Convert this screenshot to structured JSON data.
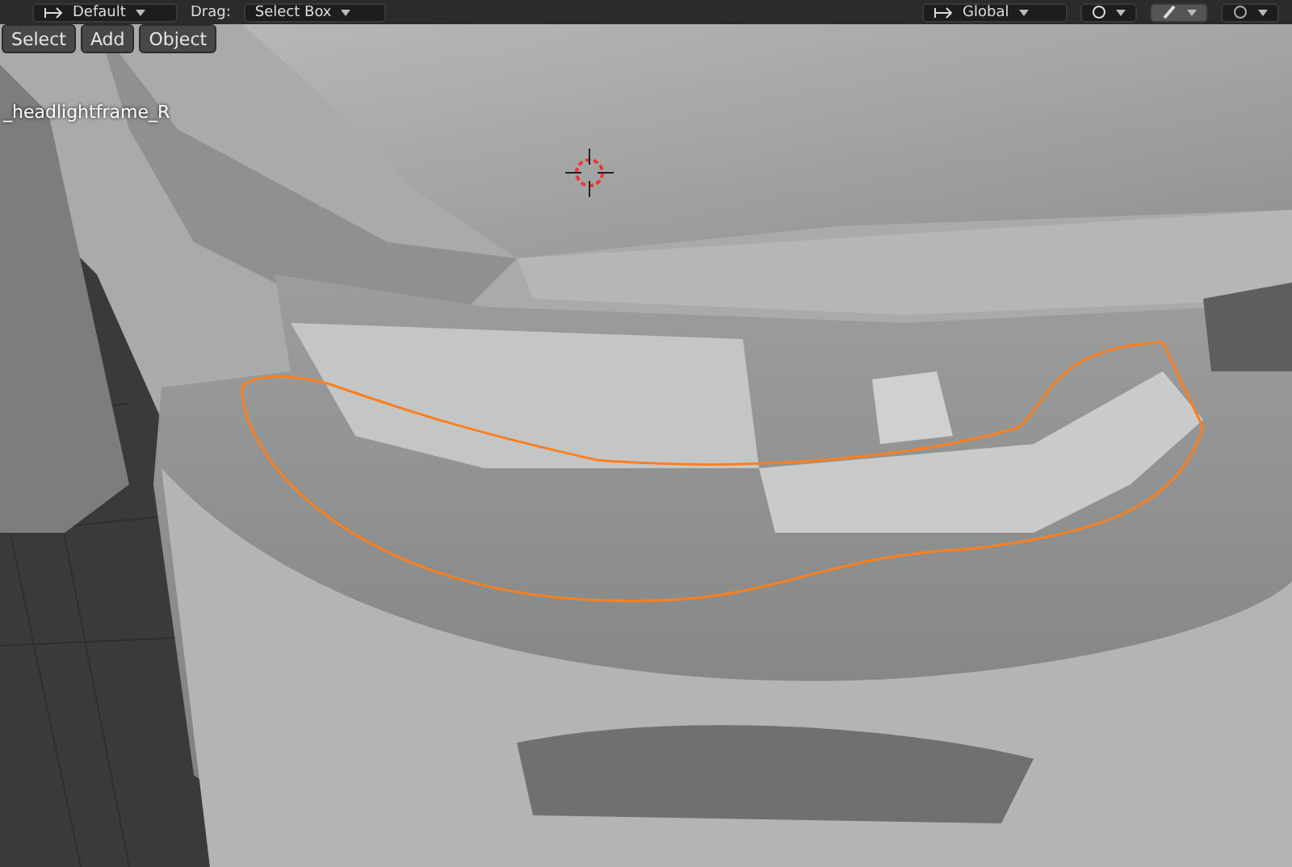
{
  "header": {
    "left": [
      {
        "kind": "dropdown",
        "label": "Default"
      },
      {
        "kind": "label",
        "label": "Drag:"
      },
      {
        "kind": "dropdown",
        "label": "Select Box"
      }
    ],
    "right": [
      {
        "kind": "dropdown",
        "label": "Global"
      },
      {
        "kind": "dropdown"
      },
      {
        "kind": "toggle",
        "on": true
      },
      {
        "kind": "toggle",
        "on": false
      }
    ]
  },
  "menus": [
    "Select",
    "Add",
    "Object"
  ],
  "object_name": "_headlightframe_R"
}
